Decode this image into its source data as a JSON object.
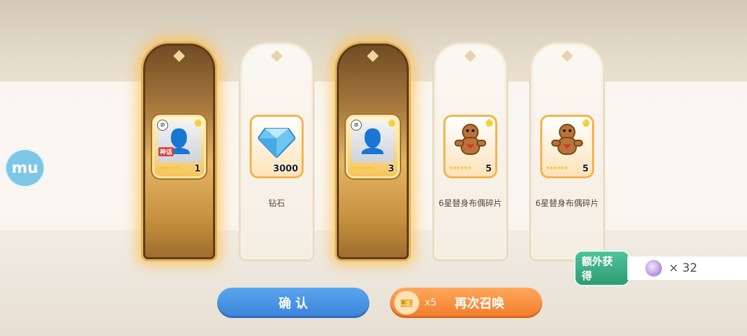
{
  "brand": {
    "logo_text": "mu"
  },
  "cards": [
    {
      "type": "gold",
      "icon": "character-portrait",
      "tag": "神话",
      "quantity": "1",
      "stars": "★★★★★★",
      "label": ""
    },
    {
      "type": "white",
      "icon": "diamond-gem",
      "tag": "",
      "quantity": "3000",
      "stars": "",
      "label": "钻石"
    },
    {
      "type": "gold",
      "icon": "character-portrait",
      "tag": "",
      "quantity": "3",
      "stars": "★★★★★★",
      "label": ""
    },
    {
      "type": "white",
      "icon": "ginger-doll",
      "tag": "",
      "quantity": "5",
      "stars": "★★★★★★",
      "label": "6星替身布偶碎片"
    },
    {
      "type": "white",
      "icon": "ginger-doll",
      "tag": "",
      "quantity": "5",
      "stars": "★★★★★★",
      "label": "6星替身布偶碎片"
    }
  ],
  "extra": {
    "badge": "额外获得",
    "icon": "purple-crystal",
    "count": "× 32"
  },
  "buttons": {
    "confirm": "确 认",
    "again_multiplier": "x5",
    "again": "再次召唤"
  }
}
